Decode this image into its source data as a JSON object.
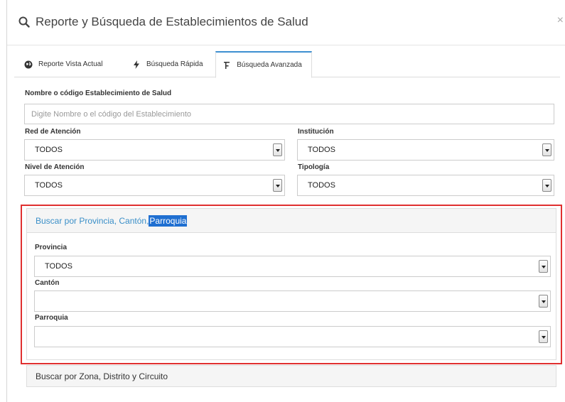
{
  "modal": {
    "title": "Reporte y Búsqueda de Establecimientos de Salud",
    "close": "×"
  },
  "tabs": [
    {
      "label": "Reporte Vista Actual",
      "icon": "globe-icon"
    },
    {
      "label": "Búsqueda Rápida",
      "icon": "bolt-icon"
    },
    {
      "label": "Búsqueda Avanzada",
      "icon": "filter-icon",
      "active": true
    }
  ],
  "form": {
    "name_label": "Nombre o código Establecimiento de Salud",
    "name_placeholder": "Digite Nombre o el código del Establecimiento",
    "red_label": "Red de Atención",
    "red_value": "TODOS",
    "institucion_label": "Institución",
    "institucion_value": "TODOS",
    "nivel_label": "Nivel de Atención",
    "nivel_value": "TODOS",
    "tipologia_label": "Tipología",
    "tipologia_value": "TODOS"
  },
  "panel_location": {
    "heading_prefix": "Buscar por Provincia, Cantón, ",
    "heading_highlight": "Parroquia",
    "provincia_label": "Provincia",
    "provincia_value": "TODOS",
    "canton_label": "Cantón",
    "canton_value": "",
    "parroquia_label": "Parroquia",
    "parroquia_value": ""
  },
  "panel_zone": {
    "heading": "Buscar por Zona, Distrito y Circuito"
  },
  "colors": {
    "accent": "#3d8fd1",
    "link": "#3a8fc8",
    "highlight": "#1f6fd1",
    "outline": "#e03030"
  }
}
